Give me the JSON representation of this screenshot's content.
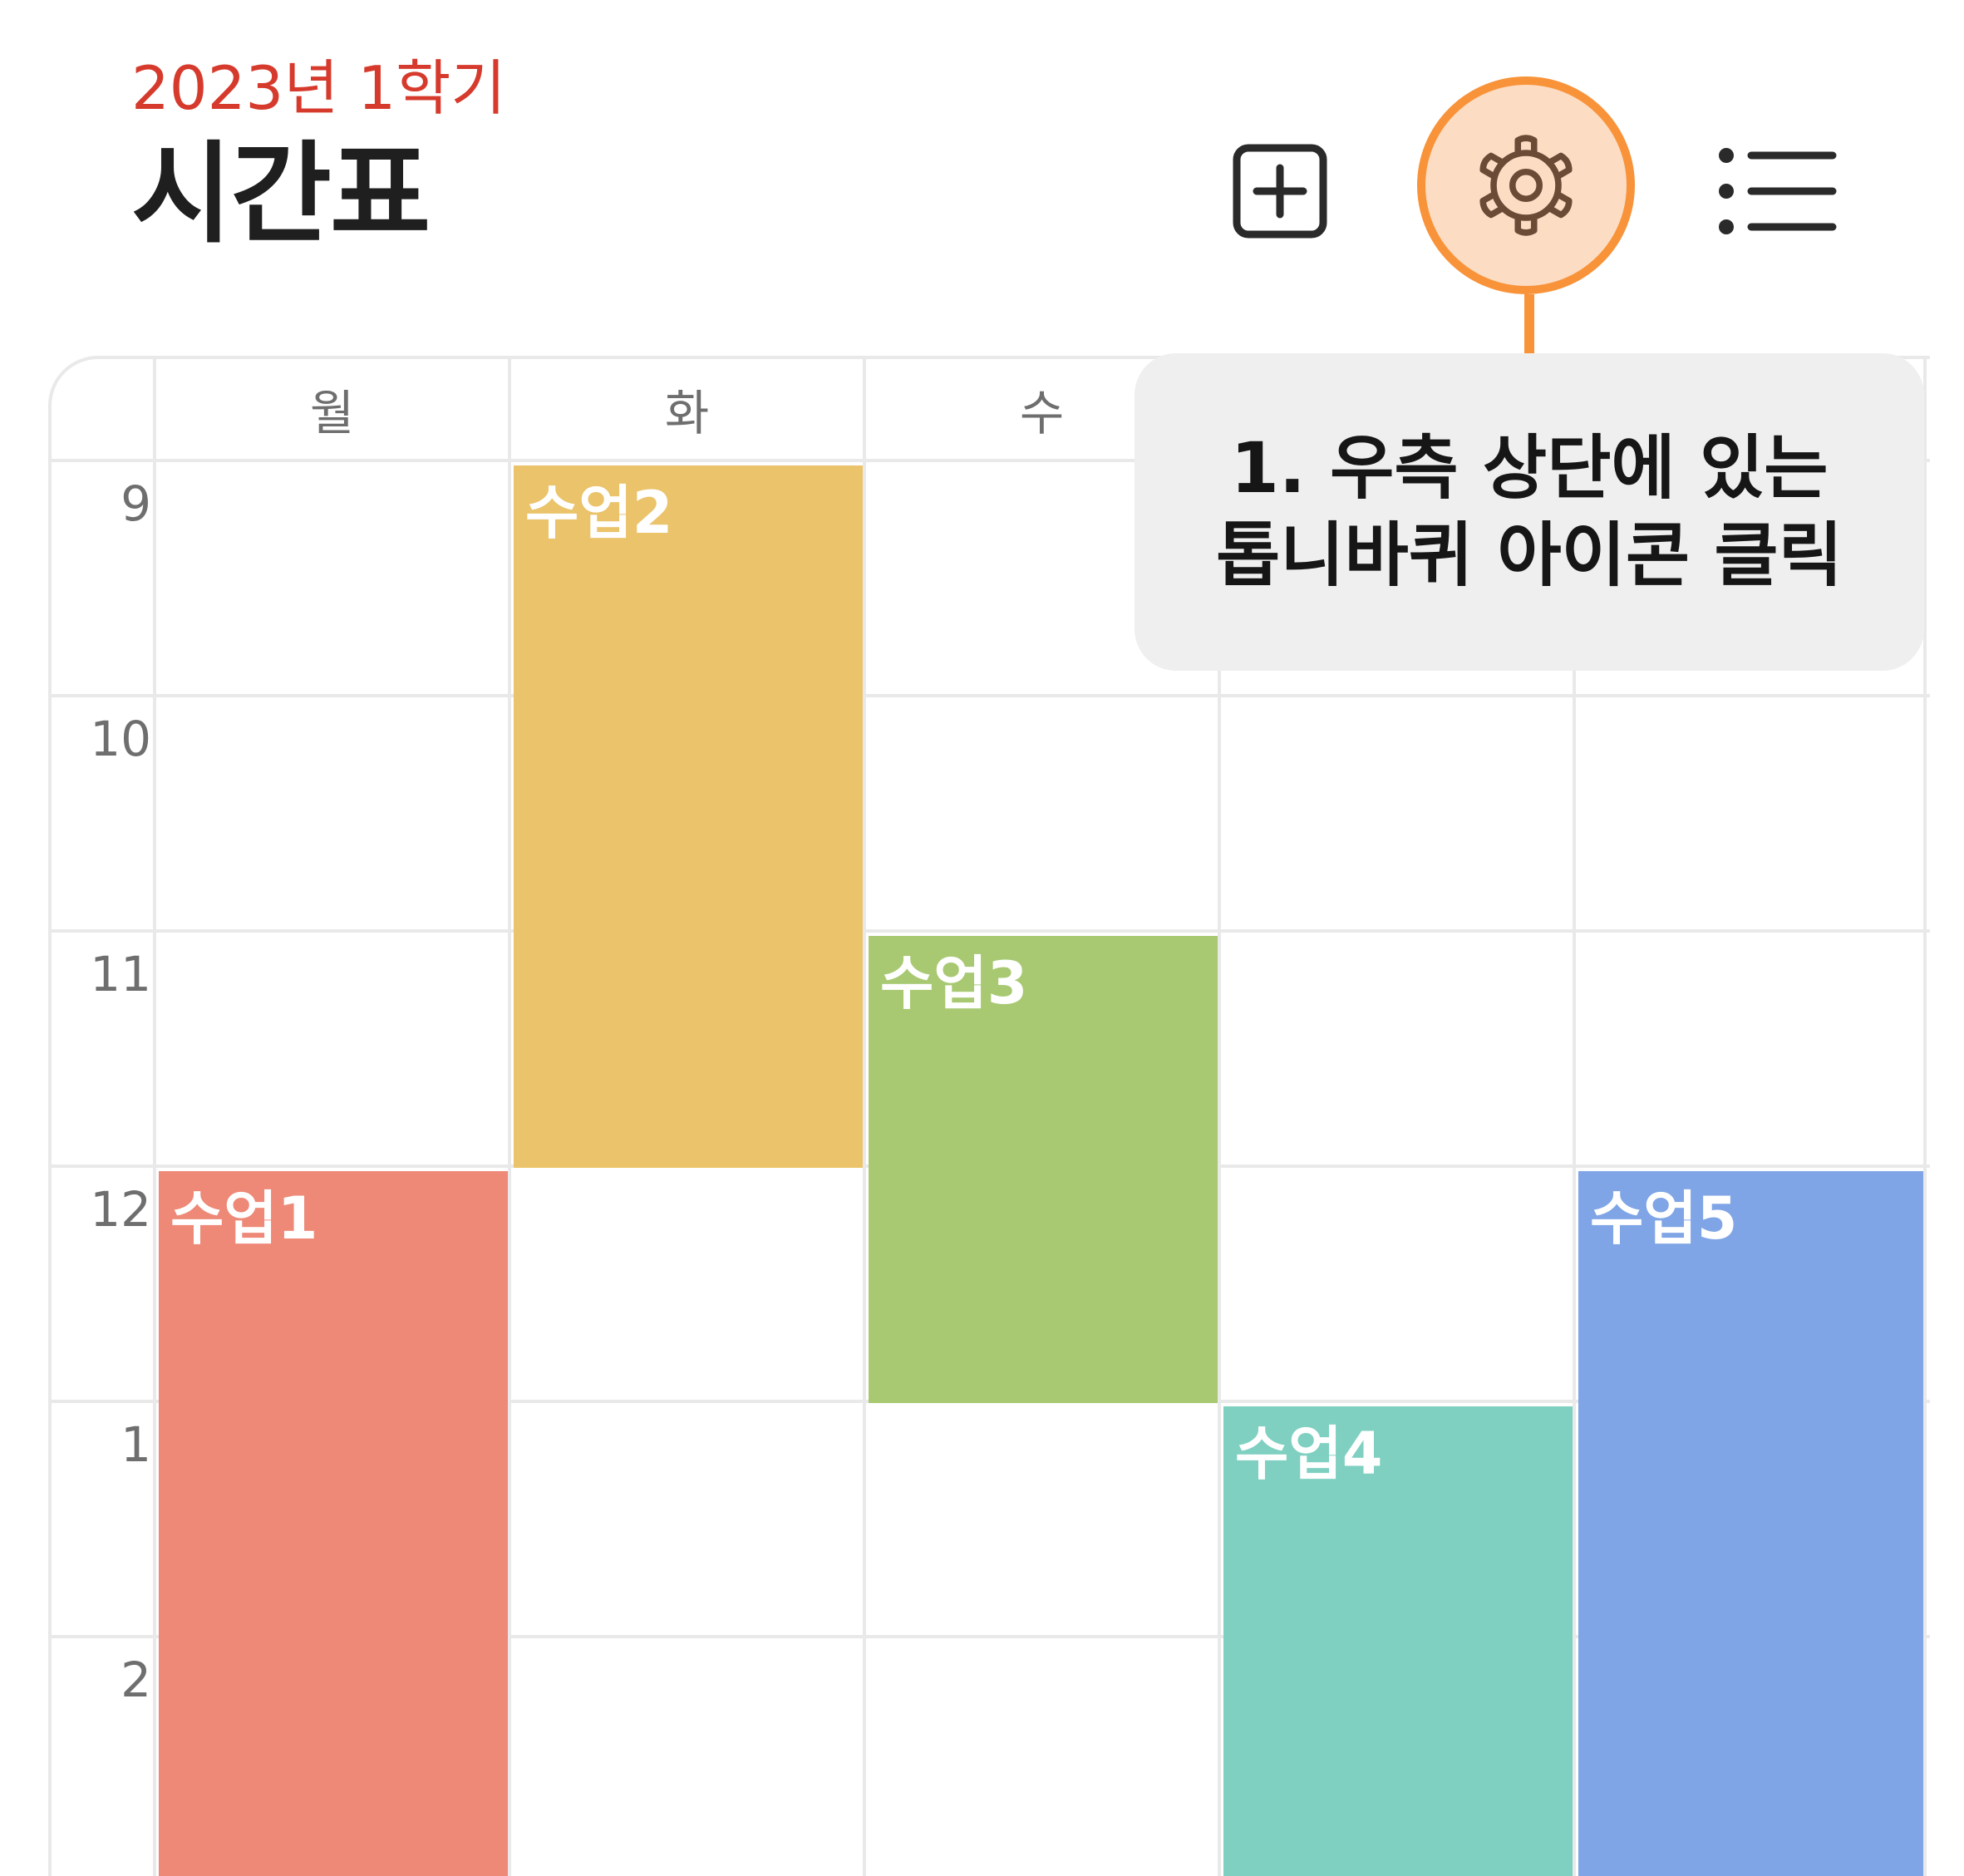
{
  "header": {
    "subtitle": "2023년 1학기",
    "title": "시간표"
  },
  "toolbar": {
    "add_icon": "plus-square-icon",
    "settings_icon": "gear-icon",
    "list_icon": "list-icon"
  },
  "timetable": {
    "days": [
      "월",
      "화",
      "수"
    ],
    "hours": [
      "9",
      "10",
      "11",
      "12",
      "1",
      "2"
    ],
    "classes": [
      {
        "name": "수업1",
        "color": "#ee8877"
      },
      {
        "name": "수업2",
        "color": "#eac36a"
      },
      {
        "name": "수업3",
        "color": "#a8c972"
      },
      {
        "name": "수업4",
        "color": "#7fd0c1"
      },
      {
        "name": "수업5",
        "color": "#7fa5e6"
      }
    ]
  },
  "callout": {
    "line1": "1. 우측 상단에 있는",
    "line2": "톱니바퀴 아이콘 클릭",
    "highlight_color": "#f8933a"
  }
}
